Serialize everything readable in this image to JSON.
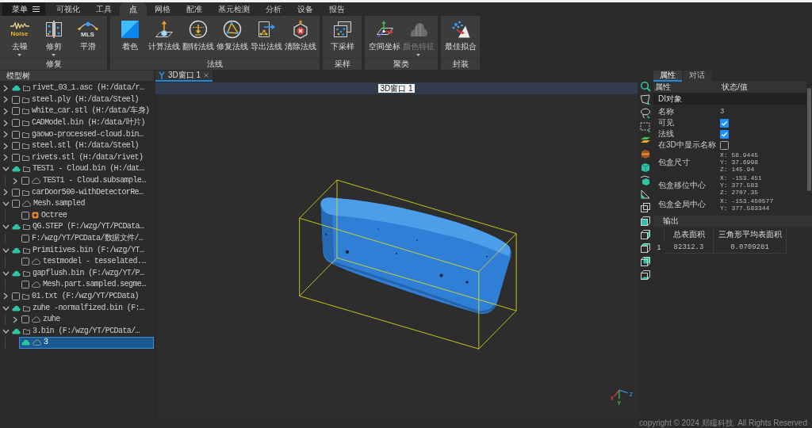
{
  "menu_bar": {
    "menu_label": "菜单",
    "tabs": [
      {
        "label": "可视化",
        "selected": false
      },
      {
        "label": "工具",
        "selected": false
      },
      {
        "label": "点",
        "selected": true
      },
      {
        "label": "网格",
        "selected": false
      },
      {
        "label": "配准",
        "selected": false
      },
      {
        "label": "基元检测",
        "selected": false
      },
      {
        "label": "分析",
        "selected": false
      },
      {
        "label": "设备",
        "selected": false
      },
      {
        "label": "报告",
        "selected": false
      }
    ]
  },
  "ribbon": {
    "groups": [
      {
        "label": "修复",
        "buttons": [
          {
            "label": "去噪",
            "icon_text": "Noise",
            "dropdown": true,
            "disabled": false
          },
          {
            "label": "修剪",
            "dropdown": true,
            "disabled": false
          },
          {
            "label": "平滑",
            "icon_text": "MLS",
            "dropdown": false,
            "disabled": false
          }
        ]
      },
      {
        "label": "法线",
        "buttons": [
          {
            "label": "着色",
            "dropdown": false,
            "disabled": false
          },
          {
            "label": "计算法线",
            "dropdown": false,
            "disabled": false
          },
          {
            "label": "翻转法线",
            "dropdown": false,
            "disabled": false
          },
          {
            "label": "修复法线",
            "dropdown": false,
            "disabled": false
          },
          {
            "label": "导出法线",
            "dropdown": false,
            "disabled": false
          },
          {
            "label": "清除法线",
            "dropdown": false,
            "disabled": false
          }
        ]
      },
      {
        "label": "采样",
        "buttons": [
          {
            "label": "下采样",
            "dropdown": false,
            "disabled": false
          }
        ]
      },
      {
        "label": "聚类",
        "buttons": [
          {
            "label": "空间坐标",
            "dropdown": false,
            "disabled": false
          },
          {
            "label": "颜色特征",
            "dropdown": true,
            "disabled": true
          }
        ]
      },
      {
        "label": "封装",
        "buttons": [
          {
            "label": "最佳拟合",
            "dropdown": false,
            "disabled": false
          }
        ]
      }
    ]
  },
  "model_tree": {
    "title": "模型树",
    "items": [
      {
        "label": "rivet_03_1.asc (H:/data/r…",
        "kind": "file",
        "checked": true,
        "expanded": false,
        "selected": false
      },
      {
        "label": "steel.ply (H:/data/Steel)",
        "kind": "file",
        "checked": false,
        "expanded": false,
        "selected": false
      },
      {
        "label": "white_car.stl (H:/data/车身)",
        "kind": "file",
        "checked": false,
        "expanded": false,
        "selected": false
      },
      {
        "label": "CADModel.bin (H:/data/叶片)",
        "kind": "file",
        "checked": false,
        "expanded": false,
        "selected": false
      },
      {
        "label": "gaowo-processed-cloud.bin…",
        "kind": "file",
        "checked": false,
        "expanded": false,
        "selected": false
      },
      {
        "label": "steel.stl (H:/data/Steel)",
        "kind": "file",
        "checked": false,
        "expanded": false,
        "selected": false
      },
      {
        "label": "rivets.stl (H:/data/rivet)",
        "kind": "file",
        "checked": false,
        "expanded": false,
        "selected": false
      },
      {
        "label": "TEST1 - Cloud.bin (H:/dat…",
        "kind": "file",
        "checked": true,
        "expanded": true,
        "selected": false,
        "children": [
          {
            "label": "TEST1 - Cloud.subsample…",
            "kind": "cloud",
            "checked": false,
            "expanded": false,
            "selected": false
          }
        ]
      },
      {
        "label": "carDoor500-withDetectorRe…",
        "kind": "file",
        "checked": false,
        "expanded": false,
        "selected": false
      },
      {
        "label": "Mesh.sampled",
        "kind": "cloud",
        "checked": false,
        "expanded": true,
        "selected": false,
        "children": [
          {
            "label": "Octree",
            "kind": "octree",
            "checked": false,
            "selected": false
          }
        ]
      },
      {
        "label": "QG.STEP (F:/wzg/YT/PCData…",
        "kind": "file",
        "checked": true,
        "expanded": true,
        "selected": false,
        "children": [
          {
            "label": "F:/wzg/YT/PCData/数据文件/…",
            "kind": "plain",
            "checked": false,
            "selected": false
          }
        ]
      },
      {
        "label": "Primitives.bin (F:/wzg/YT…",
        "kind": "file",
        "checked": true,
        "expanded": true,
        "selected": false,
        "children": [
          {
            "label": "testmodel - tesselated.…",
            "kind": "cloud",
            "checked": false,
            "selected": false
          }
        ]
      },
      {
        "label": "gapflush.bin (F:/wzg/YT/P…",
        "kind": "file",
        "checked": true,
        "expanded": true,
        "selected": false,
        "children": [
          {
            "label": "Mesh.part.sampled.segme…",
            "kind": "cloud",
            "checked": false,
            "selected": false
          }
        ]
      },
      {
        "label": "01.txt (F:/wzg/YT/PCData)",
        "kind": "file",
        "checked": false,
        "expanded": false,
        "selected": false
      },
      {
        "label": "zuhe -normalfized.bin (F:…",
        "kind": "file",
        "checked": true,
        "expanded": true,
        "selected": false,
        "children": [
          {
            "label": "zuhe",
            "kind": "cloud",
            "checked": false,
            "expanded": false,
            "selected": false
          }
        ]
      },
      {
        "label": "3.bin (F:/wzg/YT/PCData/…",
        "kind": "file",
        "checked": true,
        "expanded": true,
        "selected": false,
        "children": [
          {
            "label": "3",
            "kind": "cloud",
            "checked": true,
            "selected": true
          }
        ]
      }
    ]
  },
  "view": {
    "tabs": [
      {
        "label": "3D窗口 1",
        "selected": true
      }
    ],
    "title": "3D窗口 1",
    "axis_labels": [
      "X",
      "Y",
      "Z"
    ]
  },
  "properties": {
    "tabs": [
      {
        "label": "属性",
        "selected": true
      },
      {
        "label": "对话",
        "selected": false
      }
    ],
    "columns": [
      "属性",
      "状态/值"
    ],
    "section": "DI对象",
    "rows": [
      {
        "label": "名称",
        "kind": "text",
        "value": "3"
      },
      {
        "label": "可见",
        "kind": "check",
        "checked": true
      },
      {
        "label": "法线",
        "kind": "check",
        "checked": true
      },
      {
        "label": "在3D中显示名称",
        "kind": "check",
        "checked": false
      },
      {
        "label": "包盒尺寸",
        "kind": "coords",
        "lines": [
          "X: 58.9445",
          "Y: 37.6998",
          "Z: 145.94"
        ]
      },
      {
        "label": "包盒移位中心",
        "kind": "coords",
        "lines": [
          "X: -153.451",
          "Y: 377.583",
          "Z: 2707.35"
        ]
      },
      {
        "label": "包盒全局中心",
        "kind": "coords",
        "lines": [
          "X: -153.450577",
          "Y: 377.583344"
        ]
      }
    ]
  },
  "output": {
    "title": "输出",
    "columns": [
      "总表面积",
      "三角形平均表面积"
    ],
    "rows": [
      {
        "number": "1",
        "cells": [
          "82312.3",
          "0.0709281"
        ]
      }
    ]
  },
  "status_bar": {
    "copyright": "copyright © 2024 郑瞳科技. All Rights Reserved"
  }
}
